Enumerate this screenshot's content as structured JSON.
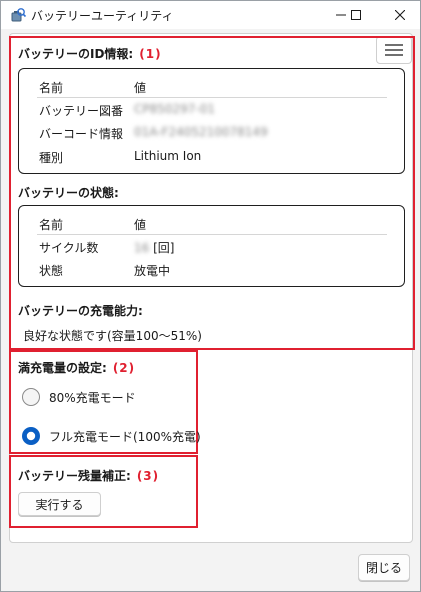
{
  "window": {
    "title": "バッテリーユーティリティ"
  },
  "section1": {
    "title": "バッテリーのID情報:",
    "marker": "(1)",
    "header": {
      "name": "名前",
      "value": "値"
    },
    "rows": [
      {
        "name": "バッテリー図番",
        "value": "CP850297-01"
      },
      {
        "name": "バーコード情報",
        "value": "01A-F2405210078149"
      },
      {
        "name": "種別",
        "value": "Lithium Ion"
      }
    ]
  },
  "status": {
    "title": "バッテリーの状態:",
    "header": {
      "name": "名前",
      "value": "値"
    },
    "rows": [
      {
        "name": "サイクル数",
        "value": "16",
        "unit": "[回]"
      },
      {
        "name": "状態",
        "value": "放電中"
      }
    ]
  },
  "capacity": {
    "title": "バッテリーの充電能力:",
    "text": "良好な状態です(容量100〜51%)"
  },
  "section2": {
    "title": "満充電量の設定:",
    "marker": "(2)",
    "options": [
      {
        "label": "80%充電モード",
        "selected": false
      },
      {
        "label": "フル充電モード(100%充電)",
        "selected": true
      }
    ]
  },
  "section3": {
    "title": "バッテリー残量補正:",
    "marker": "(3)",
    "button": "実行する"
  },
  "footer": {
    "close": "閉じる"
  },
  "colors": {
    "accent": "#0a5fc4",
    "annotation": "#e02030"
  }
}
